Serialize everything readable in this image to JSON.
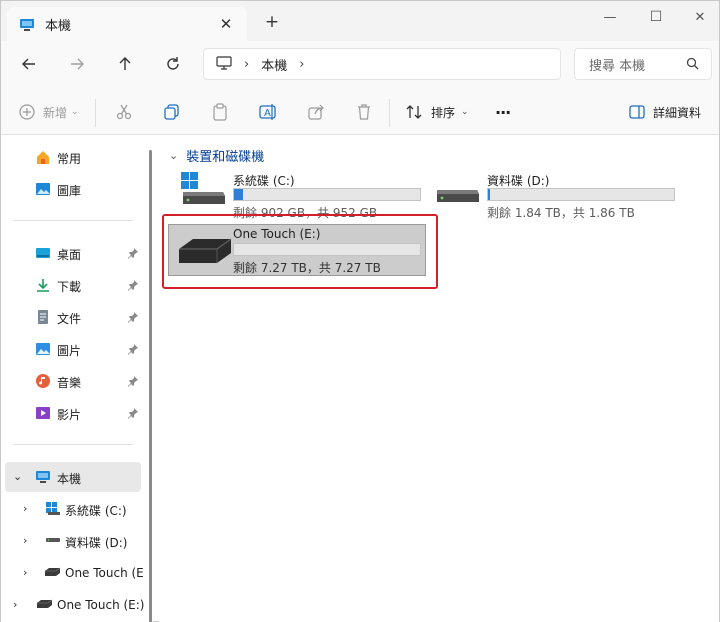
{
  "window": {
    "tab_title": "本機",
    "tab_close": "✕",
    "new_tab": "+",
    "minimize": "—",
    "restore": "☐",
    "close": "✕"
  },
  "nav": {
    "breadcrumb": [
      "本機"
    ],
    "search_placeholder": "搜尋 本機"
  },
  "commands": {
    "new_label": "新增",
    "sort_label": "排序",
    "more_label": "···",
    "details_label": "詳細資料"
  },
  "sidebar": {
    "quick": [
      {
        "label": "常用",
        "icon": "home-icon"
      },
      {
        "label": "圖庫",
        "icon": "gallery-icon"
      }
    ],
    "pinned": [
      {
        "label": "桌面",
        "icon": "desktop-icon"
      },
      {
        "label": "下載",
        "icon": "download-icon"
      },
      {
        "label": "文件",
        "icon": "document-icon"
      },
      {
        "label": "圖片",
        "icon": "pictures-icon"
      },
      {
        "label": "音樂",
        "icon": "music-icon"
      },
      {
        "label": "影片",
        "icon": "videos-icon"
      }
    ],
    "this_pc": "本機",
    "this_pc_children": [
      {
        "label": "系統碟 (C:)",
        "icon": "windows-drive-icon"
      },
      {
        "label": "資料碟 (D:)",
        "icon": "drive-icon"
      },
      {
        "label": "One Touch (E",
        "icon": "external-drive-icon"
      }
    ],
    "external": "One Touch (E:)"
  },
  "content": {
    "group_title": "裝置和磁碟機",
    "drives": [
      {
        "name": "系統碟 (C:)",
        "free": "剩餘 902 GB，共 952 GB",
        "used_fraction": 0.05,
        "icon": "windows-drive-icon"
      },
      {
        "name": "資料碟 (D:)",
        "free": "剩餘 1.84 TB，共 1.86 TB",
        "used_fraction": 0.01,
        "icon": "drive-icon"
      },
      {
        "name": "One Touch (E:)",
        "free": "剩餘 7.27 TB，共 7.27 TB",
        "used_fraction": 0.0,
        "icon": "external-drive-icon"
      }
    ]
  },
  "colors": {
    "accent": "#2f7fd6",
    "highlight": "#d21f2a",
    "folder_blue": "#003e92"
  }
}
